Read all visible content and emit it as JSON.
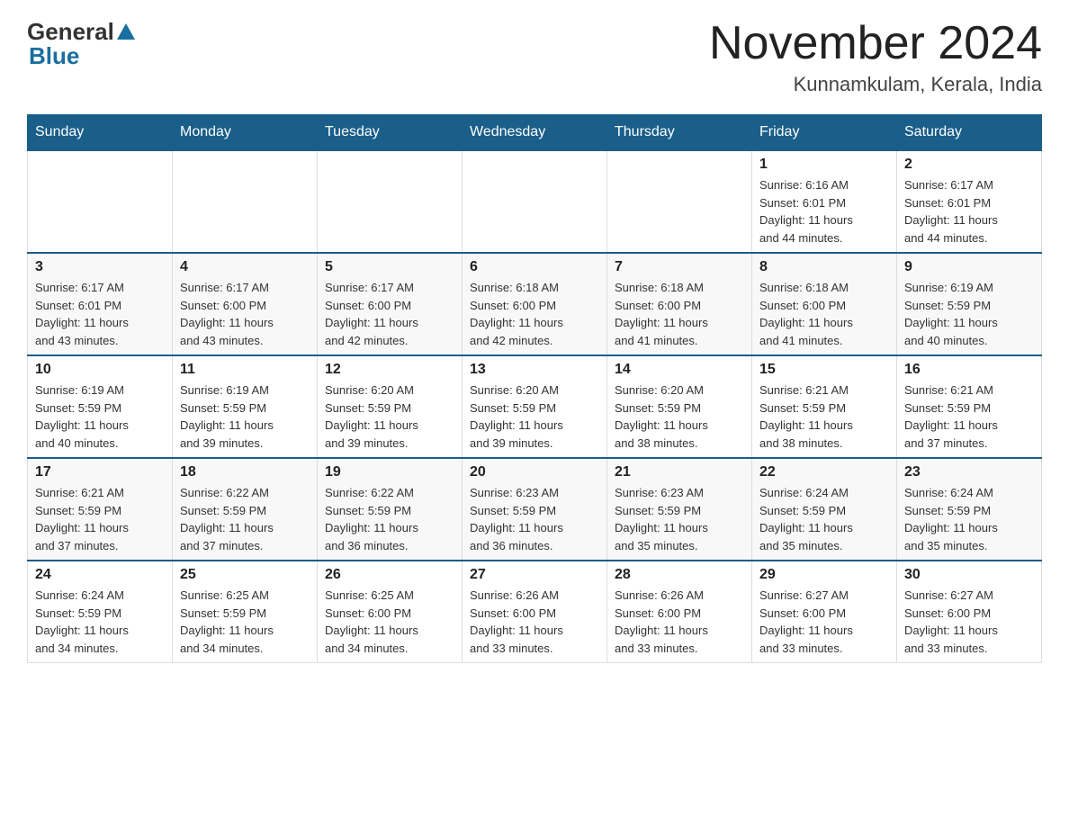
{
  "header": {
    "logo_general": "General",
    "logo_blue": "Blue",
    "title": "November 2024",
    "subtitle": "Kunnamkulam, Kerala, India"
  },
  "weekdays": [
    "Sunday",
    "Monday",
    "Tuesday",
    "Wednesday",
    "Thursday",
    "Friday",
    "Saturday"
  ],
  "weeks": [
    [
      {
        "day": "",
        "info": ""
      },
      {
        "day": "",
        "info": ""
      },
      {
        "day": "",
        "info": ""
      },
      {
        "day": "",
        "info": ""
      },
      {
        "day": "",
        "info": ""
      },
      {
        "day": "1",
        "info": "Sunrise: 6:16 AM\nSunset: 6:01 PM\nDaylight: 11 hours\nand 44 minutes."
      },
      {
        "day": "2",
        "info": "Sunrise: 6:17 AM\nSunset: 6:01 PM\nDaylight: 11 hours\nand 44 minutes."
      }
    ],
    [
      {
        "day": "3",
        "info": "Sunrise: 6:17 AM\nSunset: 6:01 PM\nDaylight: 11 hours\nand 43 minutes."
      },
      {
        "day": "4",
        "info": "Sunrise: 6:17 AM\nSunset: 6:00 PM\nDaylight: 11 hours\nand 43 minutes."
      },
      {
        "day": "5",
        "info": "Sunrise: 6:17 AM\nSunset: 6:00 PM\nDaylight: 11 hours\nand 42 minutes."
      },
      {
        "day": "6",
        "info": "Sunrise: 6:18 AM\nSunset: 6:00 PM\nDaylight: 11 hours\nand 42 minutes."
      },
      {
        "day": "7",
        "info": "Sunrise: 6:18 AM\nSunset: 6:00 PM\nDaylight: 11 hours\nand 41 minutes."
      },
      {
        "day": "8",
        "info": "Sunrise: 6:18 AM\nSunset: 6:00 PM\nDaylight: 11 hours\nand 41 minutes."
      },
      {
        "day": "9",
        "info": "Sunrise: 6:19 AM\nSunset: 5:59 PM\nDaylight: 11 hours\nand 40 minutes."
      }
    ],
    [
      {
        "day": "10",
        "info": "Sunrise: 6:19 AM\nSunset: 5:59 PM\nDaylight: 11 hours\nand 40 minutes."
      },
      {
        "day": "11",
        "info": "Sunrise: 6:19 AM\nSunset: 5:59 PM\nDaylight: 11 hours\nand 39 minutes."
      },
      {
        "day": "12",
        "info": "Sunrise: 6:20 AM\nSunset: 5:59 PM\nDaylight: 11 hours\nand 39 minutes."
      },
      {
        "day": "13",
        "info": "Sunrise: 6:20 AM\nSunset: 5:59 PM\nDaylight: 11 hours\nand 39 minutes."
      },
      {
        "day": "14",
        "info": "Sunrise: 6:20 AM\nSunset: 5:59 PM\nDaylight: 11 hours\nand 38 minutes."
      },
      {
        "day": "15",
        "info": "Sunrise: 6:21 AM\nSunset: 5:59 PM\nDaylight: 11 hours\nand 38 minutes."
      },
      {
        "day": "16",
        "info": "Sunrise: 6:21 AM\nSunset: 5:59 PM\nDaylight: 11 hours\nand 37 minutes."
      }
    ],
    [
      {
        "day": "17",
        "info": "Sunrise: 6:21 AM\nSunset: 5:59 PM\nDaylight: 11 hours\nand 37 minutes."
      },
      {
        "day": "18",
        "info": "Sunrise: 6:22 AM\nSunset: 5:59 PM\nDaylight: 11 hours\nand 37 minutes."
      },
      {
        "day": "19",
        "info": "Sunrise: 6:22 AM\nSunset: 5:59 PM\nDaylight: 11 hours\nand 36 minutes."
      },
      {
        "day": "20",
        "info": "Sunrise: 6:23 AM\nSunset: 5:59 PM\nDaylight: 11 hours\nand 36 minutes."
      },
      {
        "day": "21",
        "info": "Sunrise: 6:23 AM\nSunset: 5:59 PM\nDaylight: 11 hours\nand 35 minutes."
      },
      {
        "day": "22",
        "info": "Sunrise: 6:24 AM\nSunset: 5:59 PM\nDaylight: 11 hours\nand 35 minutes."
      },
      {
        "day": "23",
        "info": "Sunrise: 6:24 AM\nSunset: 5:59 PM\nDaylight: 11 hours\nand 35 minutes."
      }
    ],
    [
      {
        "day": "24",
        "info": "Sunrise: 6:24 AM\nSunset: 5:59 PM\nDaylight: 11 hours\nand 34 minutes."
      },
      {
        "day": "25",
        "info": "Sunrise: 6:25 AM\nSunset: 5:59 PM\nDaylight: 11 hours\nand 34 minutes."
      },
      {
        "day": "26",
        "info": "Sunrise: 6:25 AM\nSunset: 6:00 PM\nDaylight: 11 hours\nand 34 minutes."
      },
      {
        "day": "27",
        "info": "Sunrise: 6:26 AM\nSunset: 6:00 PM\nDaylight: 11 hours\nand 33 minutes."
      },
      {
        "day": "28",
        "info": "Sunrise: 6:26 AM\nSunset: 6:00 PM\nDaylight: 11 hours\nand 33 minutes."
      },
      {
        "day": "29",
        "info": "Sunrise: 6:27 AM\nSunset: 6:00 PM\nDaylight: 11 hours\nand 33 minutes."
      },
      {
        "day": "30",
        "info": "Sunrise: 6:27 AM\nSunset: 6:00 PM\nDaylight: 11 hours\nand 33 minutes."
      }
    ]
  ]
}
